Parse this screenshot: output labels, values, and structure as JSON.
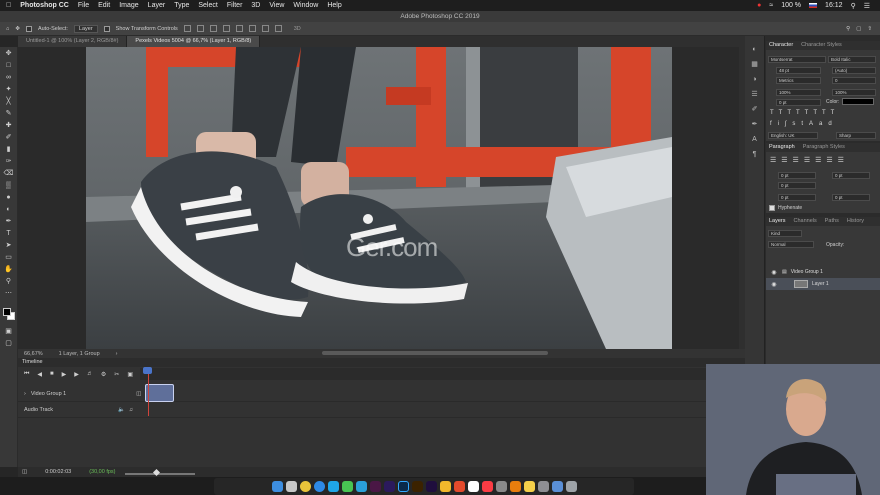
{
  "menubar": {
    "app_name": "Photoshop CC",
    "items": [
      "File",
      "Edit",
      "Image",
      "Layer",
      "Type",
      "Select",
      "Filter",
      "3D",
      "View",
      "Window",
      "Help"
    ],
    "battery": "100 %",
    "clock": "16:12"
  },
  "window_title": "Adobe Photoshop CC 2019",
  "options": {
    "auto_select_label": "Auto-Select:",
    "auto_select_value": "Layer",
    "transform_label": "Show Transform Controls"
  },
  "tabs": [
    {
      "label": "Untitled-1 @ 100% (Layer 2, RGB/8#)",
      "active": false
    },
    {
      "label": "Pexels Videos 5004 @ 66,7% (Layer 1, RGB/8)",
      "active": true
    }
  ],
  "status": {
    "zoom": "66,67%",
    "info": "1 Layer, 1 Group"
  },
  "watermark": "Ger.com",
  "timeline": {
    "title": "Timeline",
    "tracks": [
      {
        "name": "Video Group 1"
      },
      {
        "name": "Audio Track"
      }
    ],
    "timecode": "0:00:02:03",
    "fps": "(30,00 fps)"
  },
  "character": {
    "tabs": [
      "Character",
      "Character Styles"
    ],
    "font": "Montserrat",
    "style": "Bold Italic",
    "size": "48 pt",
    "leading": "(Auto)",
    "kerning": "Metrics",
    "tracking": "0",
    "vscale": "100%",
    "hscale": "100%",
    "baseline": "0 pt",
    "color_label": "Color:",
    "language": "English: UK",
    "aa": "Sharp"
  },
  "paragraph": {
    "tabs": [
      "Paragraph",
      "Paragraph Styles"
    ],
    "indent_left": "0 pt",
    "indent_right": "0 pt",
    "indent_first": "0 pt",
    "space_before": "0 pt",
    "space_after": "0 pt",
    "hyphenate": "Hyphenate"
  },
  "layers": {
    "tabs": [
      "Layers",
      "Channels",
      "Paths",
      "History"
    ],
    "kind": "Kind",
    "blend": "Normal",
    "opacity_label": "Opacity:",
    "rows": [
      {
        "name": "Video Group 1"
      },
      {
        "name": "Layer 1"
      }
    ]
  },
  "colors": {
    "accent_blue": "#4a74c9",
    "playhead": "#d0443c",
    "treadmill_red": "#d6452a"
  }
}
